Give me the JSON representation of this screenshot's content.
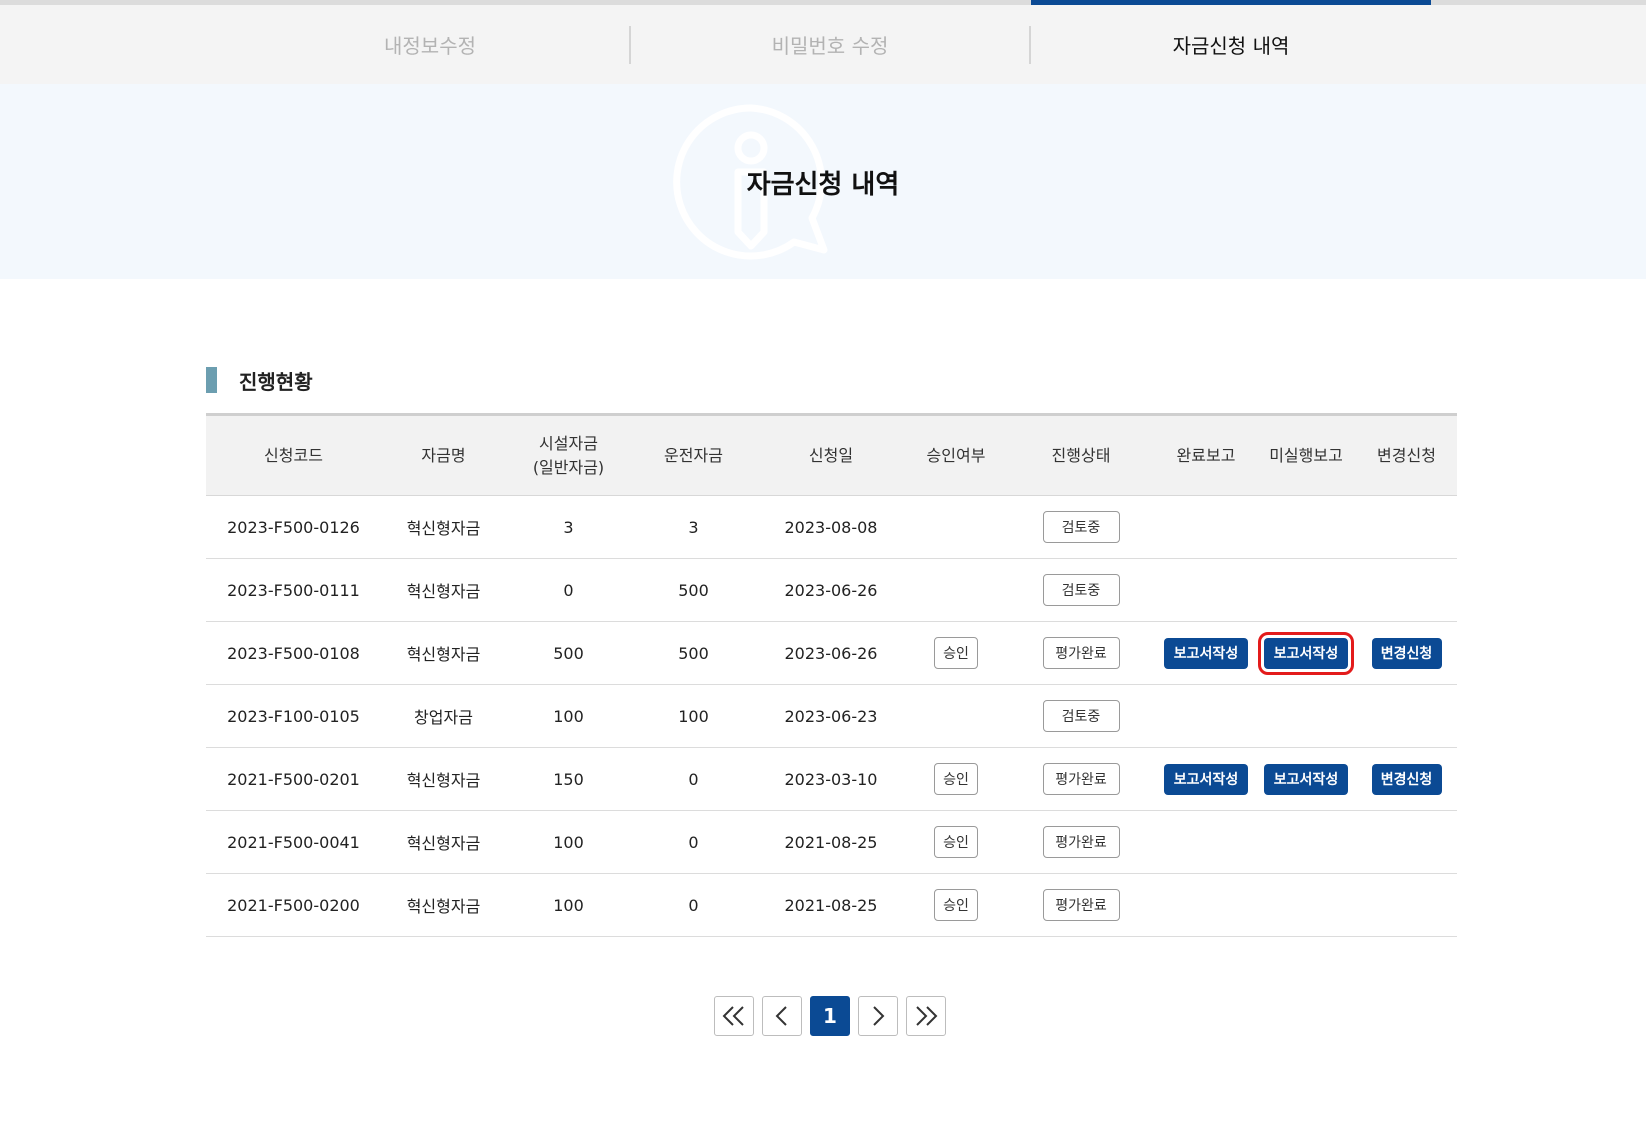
{
  "tabs": [
    {
      "label": "내정보수정",
      "active": false
    },
    {
      "label": "비밀번호 수정",
      "active": false
    },
    {
      "label": "자금신청 내역",
      "active": true
    }
  ],
  "banner": {
    "title": "자금신청 내역",
    "icon": "info-speech-bubble-icon"
  },
  "section": {
    "title": "진행현황"
  },
  "table": {
    "headers": [
      "신청코드",
      "자금명",
      "시설자금\n(일반자금)",
      "운전자금",
      "신청일",
      "승인여부",
      "진행상태",
      "완료보고",
      "미실행보고",
      "변경신청"
    ],
    "rows": [
      {
        "code": "2023-F500-0126",
        "fund": "혁신형자금",
        "facility": "3",
        "operating": "3",
        "date": "2023-08-08",
        "approval": "",
        "status": "검토중",
        "complete": "",
        "nonexec": "",
        "change": ""
      },
      {
        "code": "2023-F500-0111",
        "fund": "혁신형자금",
        "facility": "0",
        "operating": "500",
        "date": "2023-06-26",
        "approval": "",
        "status": "검토중",
        "complete": "",
        "nonexec": "",
        "change": ""
      },
      {
        "code": "2023-F500-0108",
        "fund": "혁신형자금",
        "facility": "500",
        "operating": "500",
        "date": "2023-06-26",
        "approval": "승인",
        "status": "평가완료",
        "complete": "보고서작성",
        "nonexec": "보고서작성",
        "change": "변경신청"
      },
      {
        "code": "2023-F100-0105",
        "fund": "창업자금",
        "facility": "100",
        "operating": "100",
        "date": "2023-06-23",
        "approval": "",
        "status": "검토중",
        "complete": "",
        "nonexec": "",
        "change": ""
      },
      {
        "code": "2021-F500-0201",
        "fund": "혁신형자금",
        "facility": "150",
        "operating": "0",
        "date": "2023-03-10",
        "approval": "승인",
        "status": "평가완료",
        "complete": "보고서작성",
        "nonexec": "보고서작성",
        "change": "변경신청"
      },
      {
        "code": "2021-F500-0041",
        "fund": "혁신형자금",
        "facility": "100",
        "operating": "0",
        "date": "2021-08-25",
        "approval": "승인",
        "status": "평가완료",
        "complete": "",
        "nonexec": "",
        "change": ""
      },
      {
        "code": "2021-F500-0200",
        "fund": "혁신형자금",
        "facility": "100",
        "operating": "0",
        "date": "2021-08-25",
        "approval": "승인",
        "status": "평가완료",
        "complete": "",
        "nonexec": "",
        "change": ""
      }
    ]
  },
  "pagination": {
    "current": "1",
    "first_icon": "double-chevron-left-icon",
    "prev_icon": "chevron-left-icon",
    "next_icon": "chevron-right-icon",
    "last_icon": "double-chevron-right-icon"
  },
  "colors": {
    "primary": "#0b4a94",
    "highlight": "#e31b1b",
    "banner_bg": "#f3f8fd",
    "section_bar": "#6c9eb0"
  }
}
